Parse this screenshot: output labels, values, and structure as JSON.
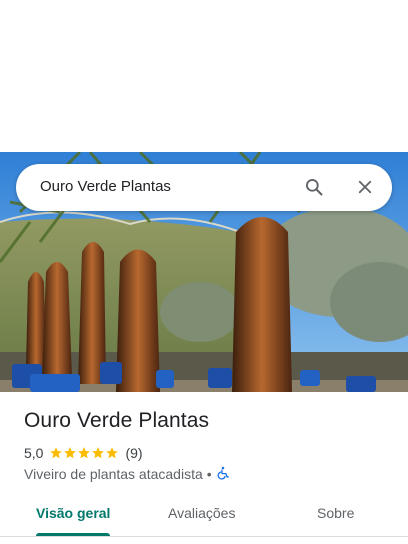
{
  "search": {
    "query": "Ouro Verde Plantas"
  },
  "place": {
    "name": "Ouro Verde Plantas",
    "rating": "5,0",
    "stars": 5,
    "review_count": "(9)",
    "category": "Viveiro de plantas atacadista",
    "separator": "•",
    "accessibility_icon": "wheelchair-icon"
  },
  "tabs": [
    {
      "label": "Visão geral",
      "active": true
    },
    {
      "label": "Avaliações",
      "active": false
    },
    {
      "label": "Sobre",
      "active": false
    }
  ],
  "colors": {
    "accent": "#00796b",
    "star": "#fbbc04",
    "accessibility": "#1a73e8"
  },
  "icons": {
    "search": "search-icon",
    "close": "close-icon",
    "star": "star-icon"
  }
}
